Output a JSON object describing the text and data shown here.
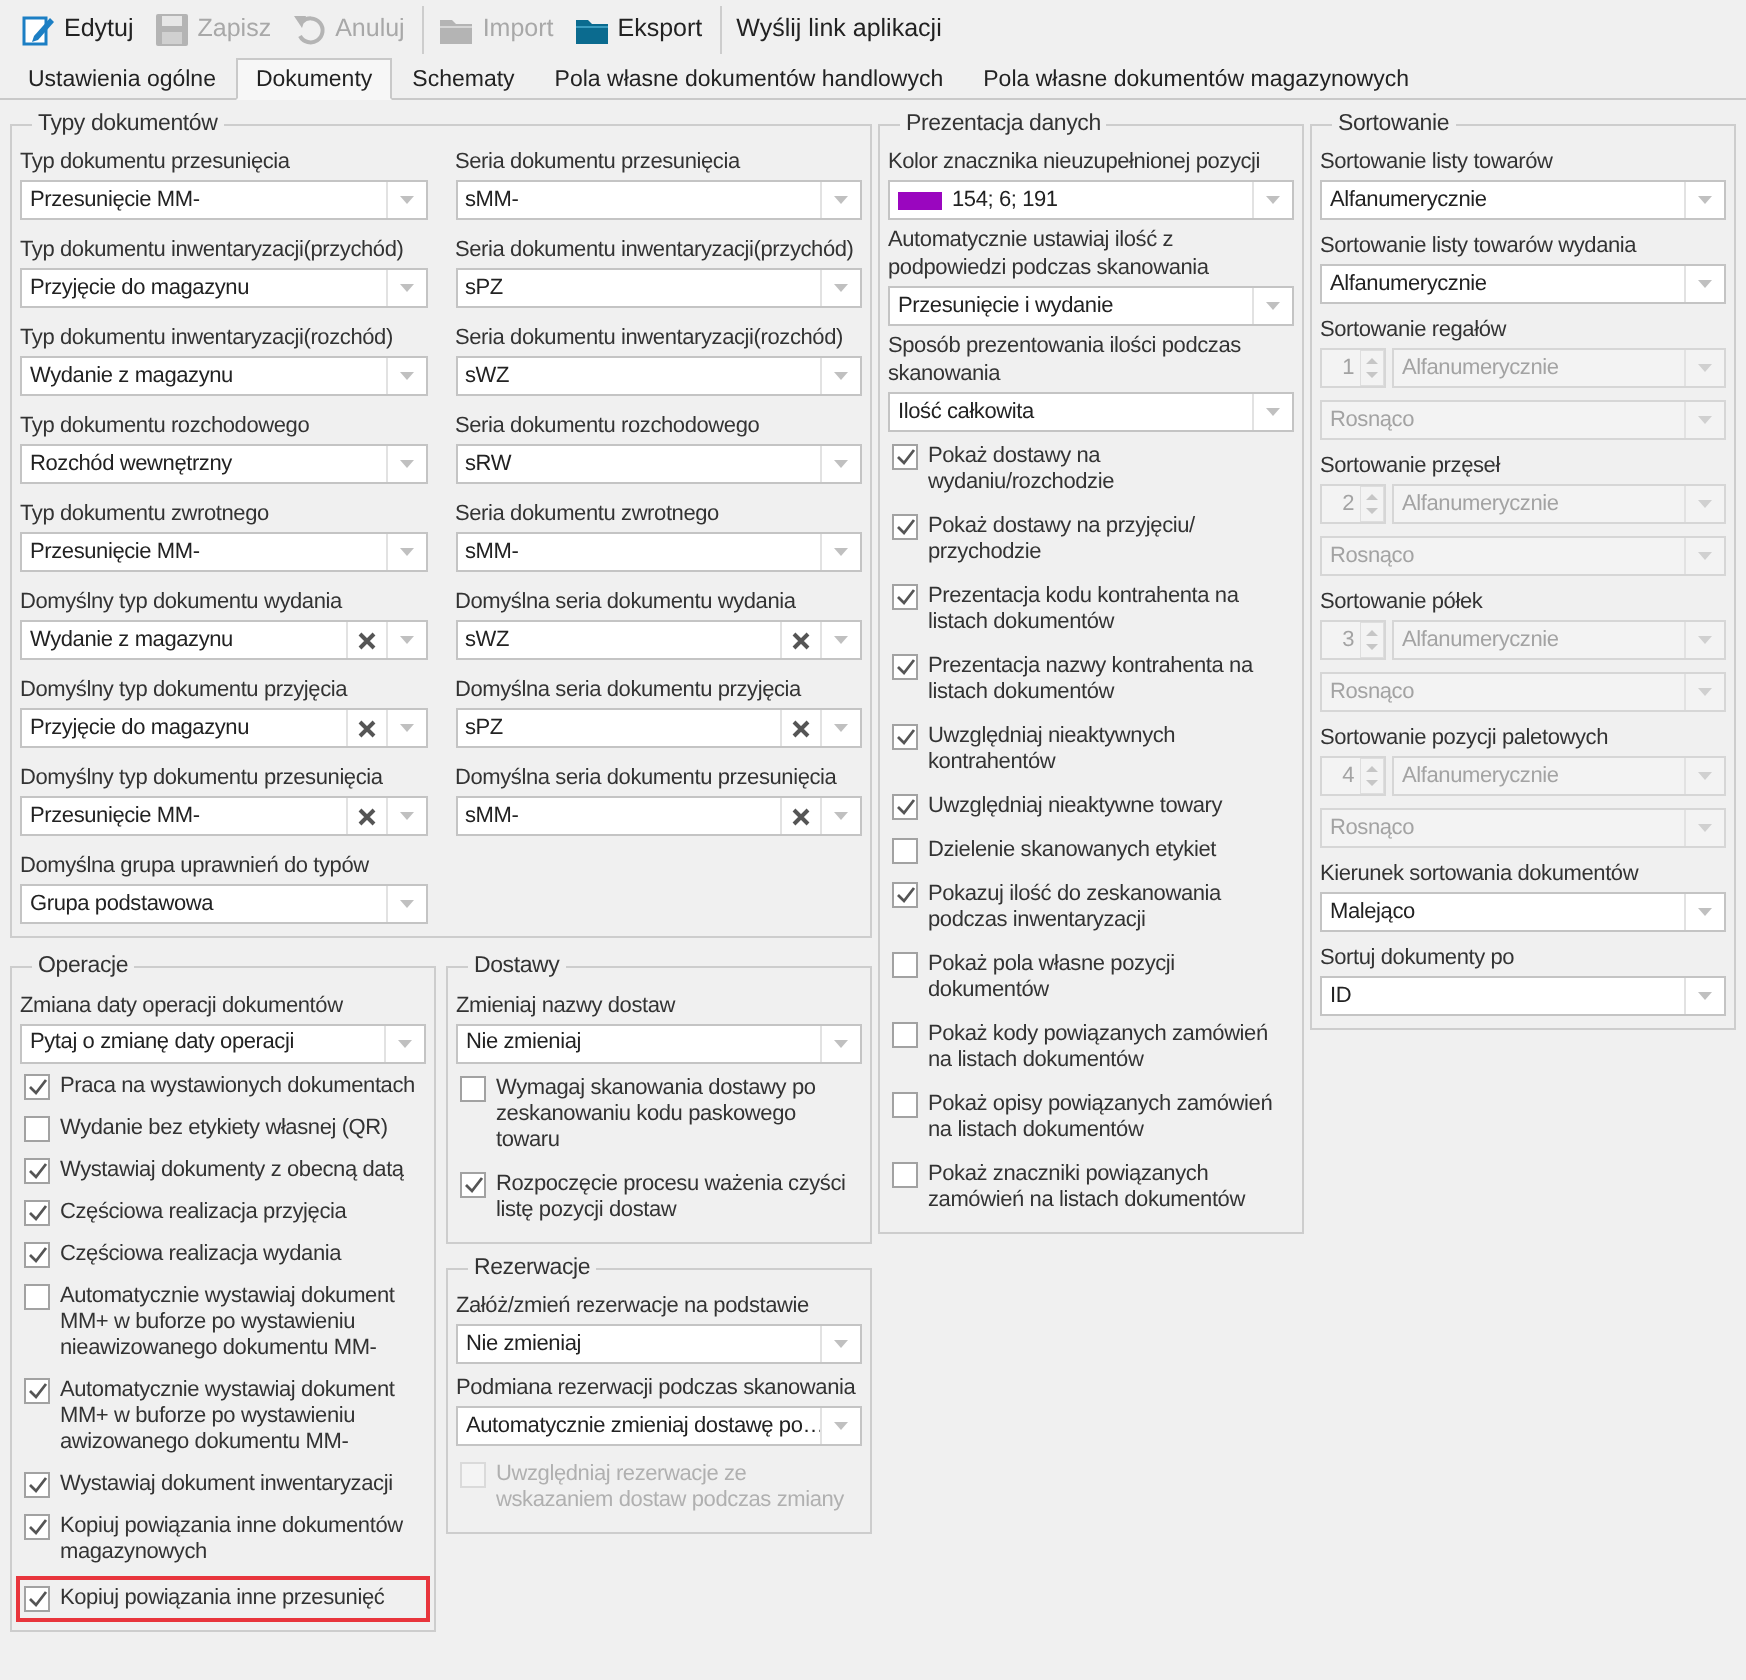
{
  "toolbar": [
    {
      "kind": "edit",
      "label": "Edytuj",
      "disabled": false,
      "separator_before": false
    },
    {
      "kind": "save",
      "label": "Zapisz",
      "disabled": true,
      "separator_before": false
    },
    {
      "kind": "undo",
      "label": "Anuluj",
      "disabled": true,
      "separator_before": false
    },
    {
      "kind": "import",
      "label": "Import",
      "disabled": true,
      "separator_before": true
    },
    {
      "kind": "export",
      "label": "Eksport",
      "disabled": false,
      "separator_before": false
    },
    {
      "kind": "link",
      "label": "Wyślij link aplikacji",
      "disabled": false,
      "separator_before": true
    }
  ],
  "tabs": [
    {
      "label": "Ustawienia ogólne",
      "selected": false
    },
    {
      "label": "Dokumenty",
      "selected": true
    },
    {
      "label": "Schematy",
      "selected": false
    },
    {
      "label": "Pola własne dokumentów handlowych",
      "selected": false
    },
    {
      "label": "Pola własne dokumentów magazynowych",
      "selected": false
    }
  ],
  "typy_dokumentow": {
    "title": "Typy dokumentów",
    "fields": [
      {
        "label": "Typ dokumentu przesunięcia",
        "value": "Przesunięcie MM-",
        "clearable": false
      },
      {
        "label": "Seria dokumentu przesunięcia",
        "value": "sMM-",
        "clearable": false
      },
      {
        "label": "Typ dokumentu inwentaryzacji(przychód)",
        "value": "Przyjęcie do magazynu",
        "clearable": false
      },
      {
        "label": "Seria dokumentu inwentaryzacji(przychód)",
        "value": "sPZ",
        "clearable": false
      },
      {
        "label": "Typ dokumentu inwentaryzacji(rozchód)",
        "value": "Wydanie z magazynu",
        "clearable": false
      },
      {
        "label": "Seria dokumentu inwentaryzacji(rozchód)",
        "value": "sWZ",
        "clearable": false
      },
      {
        "label": "Typ dokumentu rozchodowego",
        "value": "Rozchód wewnętrzny",
        "clearable": false
      },
      {
        "label": "Seria dokumentu rozchodowego",
        "value": "sRW",
        "clearable": false
      },
      {
        "label": "Typ dokumentu zwrotnego",
        "value": "Przesunięcie MM-",
        "clearable": false
      },
      {
        "label": "Seria dokumentu zwrotnego",
        "value": "sMM-",
        "clearable": false
      },
      {
        "label": "Domyślny typ dokumentu wydania",
        "value": "Wydanie z magazynu",
        "clearable": true
      },
      {
        "label": "Domyślna seria dokumentu wydania",
        "value": "sWZ",
        "clearable": true
      },
      {
        "label": "Domyślny typ dokumentu przyjęcia",
        "value": "Przyjęcie do magazynu",
        "clearable": true
      },
      {
        "label": "Domyślna seria dokumentu przyjęcia",
        "value": "sPZ",
        "clearable": true
      },
      {
        "label": "Domyślny typ dokumentu przesunięcia",
        "value": "Przesunięcie MM-",
        "clearable": true
      },
      {
        "label": "Domyślna seria dokumentu przesunięcia",
        "value": "sMM-",
        "clearable": true
      },
      {
        "label": "Domyślna grupa uprawnień do typów",
        "value": "Grupa podstawowa",
        "clearable": false
      }
    ]
  },
  "operacje": {
    "title": "Operacje",
    "fields": [
      {
        "label": "Zmiana daty operacji dokumentów",
        "value": "Pytaj o zmianę daty operacji"
      }
    ],
    "checkboxes": [
      {
        "label": "Praca na wystawionych dokumentach",
        "checked": true,
        "highlighted": false
      },
      {
        "label": "Wydanie bez etykiety własnej (QR)",
        "checked": false,
        "highlighted": false
      },
      {
        "label": "Wystawiaj dokumenty z obecną datą",
        "checked": true,
        "highlighted": false
      },
      {
        "label": "Częściowa realizacja przyjęcia",
        "checked": true,
        "highlighted": false
      },
      {
        "label": "Częściowa realizacja wydania",
        "checked": true,
        "highlighted": false
      },
      {
        "label": "Automatycznie wystawiaj dokument MM+ w buforze po wystawieniu nieawizowanego dokumentu MM-",
        "checked": false,
        "highlighted": false
      },
      {
        "label": "Automatycznie wystawiaj dokument MM+ w buforze po wystawieniu awizowanego dokumentu MM-",
        "checked": true,
        "highlighted": false
      },
      {
        "label": "Wystawiaj dokument inwentaryzacji",
        "checked": true,
        "highlighted": false
      },
      {
        "label": "Kopiuj powiązania inne dokumentów magazynowych",
        "checked": true,
        "highlighted": false
      },
      {
        "label": "Kopiuj powiązania inne przesunięć",
        "checked": true,
        "highlighted": true
      }
    ]
  },
  "dostawy": {
    "title": "Dostawy",
    "fields": [
      {
        "label": "Zmieniaj nazwy dostaw",
        "value": "Nie zmieniaj"
      }
    ],
    "checkboxes": [
      {
        "label": "Wymagaj skanowania dostawy po zeskanowaniu kodu paskowego towaru",
        "checked": false
      },
      {
        "label": "Rozpoczęcie procesu ważenia czyści listę pozycji dostaw",
        "checked": true
      }
    ]
  },
  "rezerwacje": {
    "title": "Rezerwacje",
    "fields": [
      {
        "label": "Załóż/zmień rezerwacje na podstawie",
        "value": "Nie zmieniaj"
      },
      {
        "label": "Podmiana rezerwacji podczas skanowania",
        "value": "Automatycznie zmieniaj dostawę po…"
      }
    ],
    "checkboxes": [
      {
        "label": "Uwzględniaj rezerwacje ze wskazaniem dostaw podczas zmiany",
        "checked": false,
        "disabled": true
      }
    ]
  },
  "prezentacja_danych": {
    "title": "Prezentacja danych",
    "fields": [
      {
        "kind": "color",
        "label": "Kolor znacznika nieuzupełnionej pozycji",
        "value": "154; 6; 191",
        "color": "#9a06bf"
      },
      {
        "kind": "combo",
        "label": "Automatycznie ustawiaj ilość z podpowiedzi podczas skanowania",
        "value": "Przesunięcie i wydanie"
      },
      {
        "kind": "combo",
        "label": "Sposób prezentowania ilości podczas skanowania",
        "value": "Ilość całkowita"
      }
    ],
    "checkboxes": [
      {
        "label": "Pokaż dostawy na wydaniu/rozchodzie",
        "checked": true
      },
      {
        "label": "Pokaż dostawy na przyjęciu/ przychodzie",
        "checked": true
      },
      {
        "label": "Prezentacja kodu kontrahenta na listach dokumentów",
        "checked": true
      },
      {
        "label": "Prezentacja nazwy kontrahenta na listach dokumentów",
        "checked": true
      },
      {
        "label": "Uwzględniaj nieaktywnych kontrahentów",
        "checked": true
      },
      {
        "label": "Uwzględniaj nieaktywne towary",
        "checked": true
      },
      {
        "label": "Dzielenie skanowanych etykiet",
        "checked": false
      },
      {
        "label": "Pokazuj ilość do zeskanowania podczas inwentaryzacji",
        "checked": true
      },
      {
        "label": "Pokaż pola własne pozycji dokumentów",
        "checked": false
      },
      {
        "label": "Pokaż kody powiązanych zamówień na listach dokumentów",
        "checked": false
      },
      {
        "label": "Pokaż opisy powiązanych zamówień na listach dokumentów",
        "checked": false
      },
      {
        "label": "Pokaż znaczniki powiązanych zamówień na listach dokumentów",
        "checked": false
      }
    ]
  },
  "sortowanie": {
    "title": "Sortowanie",
    "fields": [
      {
        "kind": "combo",
        "label": "Sortowanie listy towarów",
        "value": "Alfanumerycznie"
      },
      {
        "kind": "combo",
        "label": "Sortowanie listy towarów wydania",
        "value": "Alfanumerycznie"
      },
      {
        "kind": "sort_level",
        "label": "Sortowanie regałów",
        "order": "1",
        "value": "Alfanumerycznie",
        "direction": "Rosnąco",
        "disabled": true
      },
      {
        "kind": "sort_level",
        "label": "Sortowanie przęseł",
        "order": "2",
        "value": "Alfanumerycznie",
        "direction": "Rosnąco",
        "disabled": true
      },
      {
        "kind": "sort_level",
        "label": "Sortowanie półek",
        "order": "3",
        "value": "Alfanumerycznie",
        "direction": "Rosnąco",
        "disabled": true
      },
      {
        "kind": "sort_level",
        "label": "Sortowanie pozycji paletowych",
        "order": "4",
        "value": "Alfanumerycznie",
        "direction": "Rosnąco",
        "disabled": true
      },
      {
        "kind": "combo",
        "label": "Kierunek sortowania dokumentów",
        "value": "Malejąco"
      },
      {
        "kind": "combo",
        "label": "Sortuj dokumenty po",
        "value": "ID"
      }
    ]
  }
}
